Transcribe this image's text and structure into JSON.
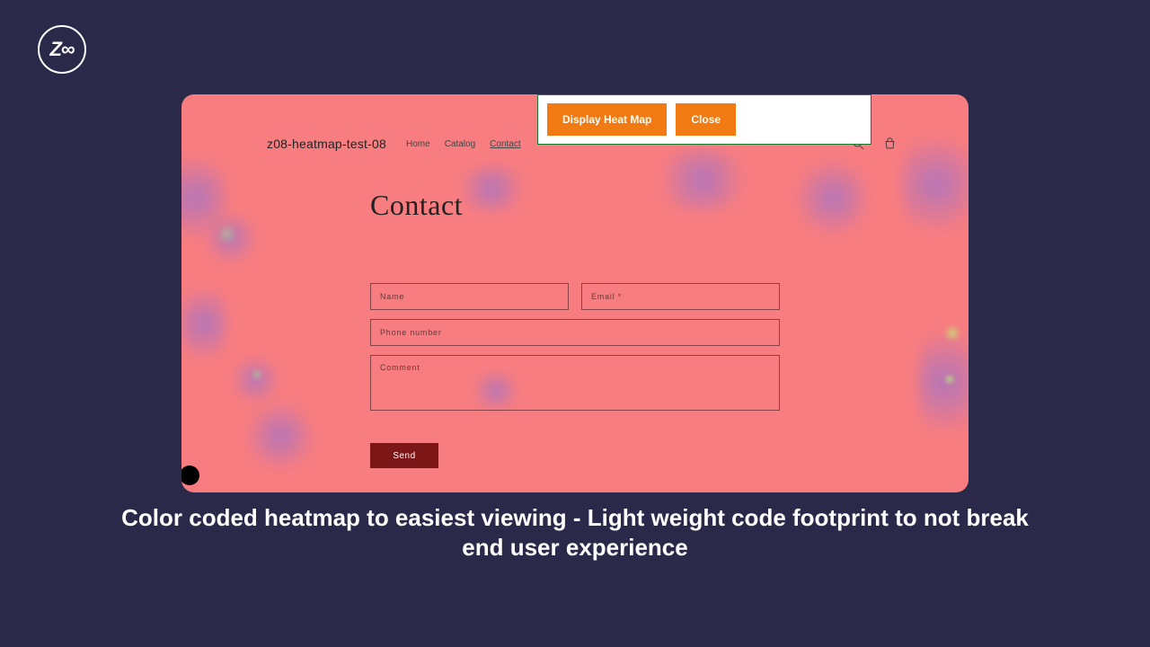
{
  "logo_text": "Z∞",
  "toolbar": {
    "display_label": "Display Heat Map",
    "close_label": "Close"
  },
  "header": {
    "site_name": "z08-heatmap-test-08",
    "nav": {
      "home": "Home",
      "catalog": "Catalog",
      "contact": "Contact"
    }
  },
  "page": {
    "title": "Contact",
    "placeholders": {
      "name": "Name",
      "email": "Email *",
      "phone": "Phone number",
      "comment": "Comment"
    },
    "send_label": "Send"
  },
  "caption": "Color coded heatmap to easiest viewing - Light weight code footprint to not break end user experience"
}
